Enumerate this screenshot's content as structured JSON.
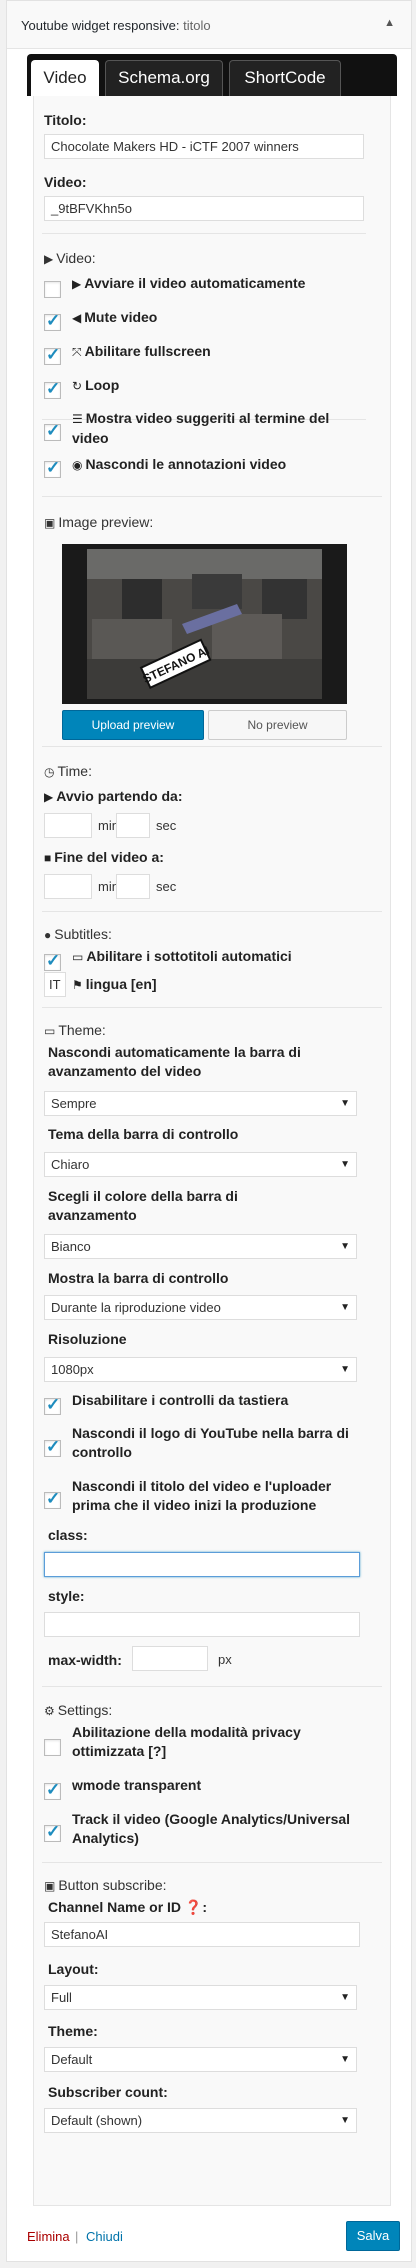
{
  "widget": {
    "title": "Youtube widget responsive:",
    "subtitle": "titolo",
    "toggle": "▲"
  },
  "tabs": [
    "Video",
    "Schema.org",
    "ShortCode"
  ],
  "fields": {
    "titolo_label": "Titolo:",
    "titolo_value": "Chocolate Makers HD - iCTF 2007 winners",
    "video_label": "Video:",
    "video_value": "_9tBFVKhn5o"
  },
  "video_section": {
    "heading": "Video:",
    "options": [
      {
        "label": "Avviare il video automaticamente",
        "icon": "▶",
        "checked": false
      },
      {
        "label": "Mute video",
        "icon": "◀",
        "checked": true
      },
      {
        "label": "Abilitare fullscreen",
        "icon": "⤧",
        "checked": true
      },
      {
        "label": "Loop",
        "icon": "↻",
        "checked": true
      },
      {
        "label": "Mostra video suggeriti al termine del video",
        "icon": "☰",
        "checked": true
      },
      {
        "label": "Nascondi le annotazioni video",
        "icon": "◉",
        "checked": true
      }
    ]
  },
  "image_preview": {
    "heading": "Image preview:",
    "sticker": "STEFANO AI",
    "upload": "Upload preview",
    "none": "No preview"
  },
  "time": {
    "heading": "Time:",
    "start_label": "Avvio partendo da:",
    "end_label": "Fine del video a:",
    "min": "min",
    "sec": "sec"
  },
  "subtitles": {
    "heading": "Subtitles:",
    "auto_label": "Abilitare i sottotitoli automatici",
    "lang_value": "IT",
    "lang_label": "lingua [en]"
  },
  "theme": {
    "heading": "Theme:",
    "hide_bar_label": "Nascondi automaticamente la barra di avanzamento del video",
    "hide_bar_value": "Sempre",
    "control_theme_label": "Tema della barra di controllo",
    "control_theme_value": "Chiaro",
    "color_label": "Scegli il colore della barra di avanzamento",
    "color_value": "Bianco",
    "show_bar_label": "Mostra la barra di controllo",
    "show_bar_value": "Durante la riproduzione video",
    "resolution_label": "Risoluzione",
    "resolution_value": "1080px",
    "checks": [
      {
        "label": "Disabilitare i controlli da tastiera",
        "checked": true
      },
      {
        "label": "Nascondi il logo di YouTube nella barra di controllo",
        "checked": true
      },
      {
        "label": "Nascondi il titolo del video e l'uploader prima che il video inizi la produzione",
        "checked": true
      }
    ],
    "class_label": "class:",
    "style_label": "style:",
    "maxwidth_label": "max-width:",
    "px": "px"
  },
  "settings": {
    "heading": "Settings:",
    "checks": [
      {
        "label": "Abilitazione della modalità privacy ottimizzata [?]",
        "checked": false
      },
      {
        "label": "wmode transparent",
        "checked": true
      },
      {
        "label": "Track il video (Google Analytics/Universal Analytics)",
        "checked": true
      }
    ]
  },
  "subscribe": {
    "heading": "Button subscribe:",
    "channel_label": "Channel Name or ID ❓:",
    "channel_value": "StefanoAI",
    "layout_label": "Layout:",
    "layout_value": "Full",
    "theme_label": "Theme:",
    "theme_value": "Default",
    "count_label": "Subscriber count:",
    "count_value": "Default (shown)"
  },
  "footer": {
    "delete": "Elimina",
    "sep": "|",
    "close": "Chiudi",
    "save": "Salva"
  },
  "colors": {
    "primary": "#0085ba",
    "check": "#1e8cbe",
    "delete": "#a00"
  }
}
